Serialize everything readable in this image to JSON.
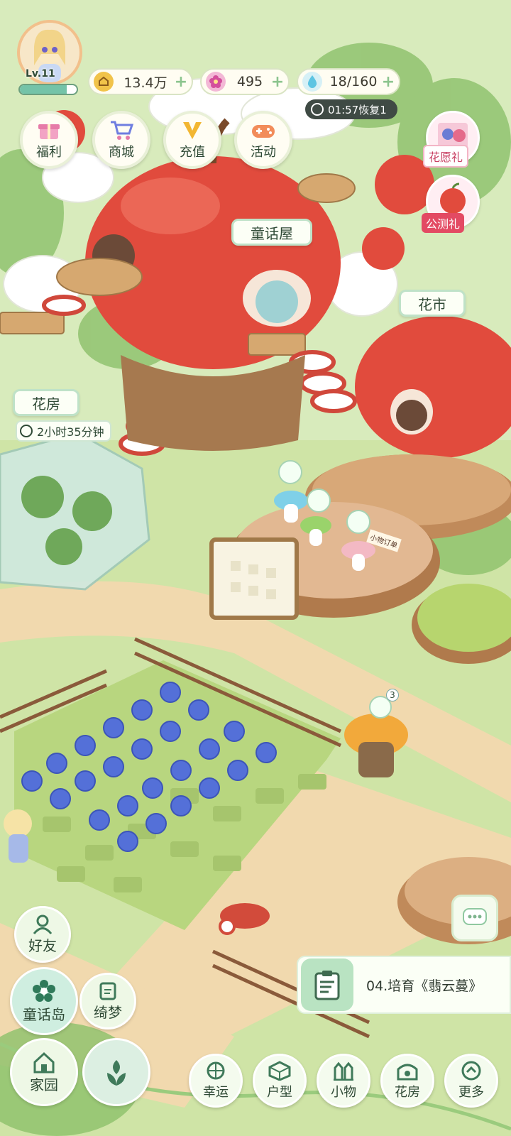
{
  "player": {
    "level_label": "Lv.11",
    "xp_fraction": 0.82
  },
  "resources": {
    "coins": "13.4万",
    "gems": "495",
    "water": "18/160",
    "water_timer": "01:57恢复1"
  },
  "top_buttons": {
    "welfare": "福利",
    "shop": "商城",
    "recharge": "充值",
    "events": "活动"
  },
  "gifts": {
    "wish_gift": "花愿礼",
    "beta_gift": "公测礼"
  },
  "map_labels": {
    "fairy_house": "童话屋",
    "flower_market": "花市",
    "greenhouse": "花房",
    "greenhouse_timer": "2小时35分钟",
    "board_sign": "小物订单"
  },
  "badges": {
    "mailbox_count": "3"
  },
  "quest": {
    "text": "04.培育《翡云蔓》"
  },
  "side_buttons": {
    "friends": "好友",
    "fairy_island": "童话岛",
    "dream": "绮梦"
  },
  "bottom_nav": {
    "home": "家园",
    "luck": "幸运",
    "layout": "户型",
    "items": "小物",
    "flower_room": "花房",
    "more": "更多"
  },
  "colors": {
    "accent": "#74c3a8",
    "apple": "#e14b3d",
    "panel": "#fcfff6"
  }
}
